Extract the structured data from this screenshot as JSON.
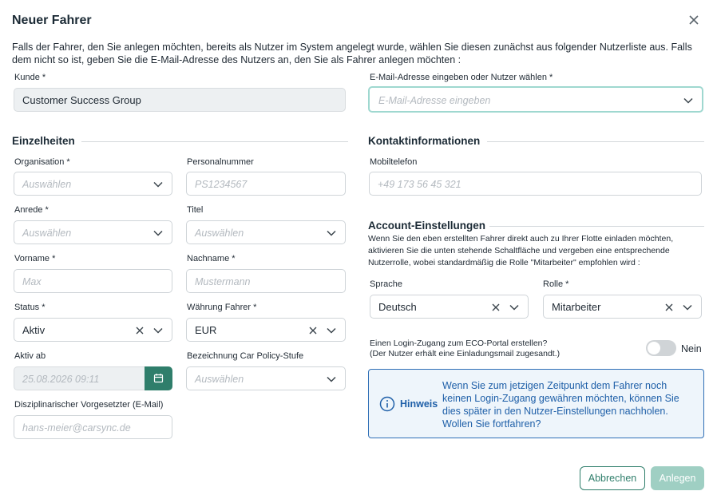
{
  "dialog": {
    "title": "Neuer Fahrer",
    "intro": "Falls der Fahrer, den Sie anlegen möchten, bereits als Nutzer im System angelegt wurde, wählen Sie diesen zunächst aus folgender Nutzerliste aus. Falls dem nicht so ist, geben Sie die E-Mail-Adresse des Nutzers an, den Sie als Fahrer anlegen möchten :"
  },
  "customer": {
    "label": "Kunde *",
    "value": "Customer Success Group"
  },
  "email": {
    "label": "E-Mail-Adresse eingeben oder Nutzer wählen *",
    "placeholder": "E-Mail-Adresse eingeben"
  },
  "details": {
    "title": "Einzelheiten",
    "organisation": {
      "label": "Organisation *",
      "placeholder": "Auswählen"
    },
    "personalnummer": {
      "label": "Personalnummer",
      "placeholder": "PS1234567"
    },
    "anrede": {
      "label": "Anrede *",
      "placeholder": "Auswählen"
    },
    "titel": {
      "label": "Titel",
      "placeholder": "Auswählen"
    },
    "vorname": {
      "label": "Vorname *",
      "placeholder": "Max"
    },
    "nachname": {
      "label": "Nachname *",
      "placeholder": "Mustermann"
    },
    "status": {
      "label": "Status *",
      "value": "Aktiv"
    },
    "waehrung": {
      "label": "Währung Fahrer *",
      "value": "EUR"
    },
    "aktiv_ab": {
      "label": "Aktiv ab",
      "placeholder": "25.08.2026 09:11"
    },
    "car_policy": {
      "label": "Bezeichnung Car Policy-Stufe",
      "placeholder": "Auswählen"
    },
    "vorgesetzter": {
      "label": "Disziplinarischer Vorgesetzter (E-Mail)",
      "placeholder": "hans-meier@carsync.de"
    }
  },
  "contact": {
    "title": "Kontaktinformationen",
    "mobil": {
      "label": "Mobiltelefon",
      "placeholder": "+49 173 56 45 321"
    }
  },
  "account": {
    "title": "Account-Einstellungen",
    "text": "Wenn Sie den eben erstellten Fahrer direkt auch zu Ihrer Flotte einladen möchten, aktivieren Sie die unten stehende Schaltfläche und vergeben eine entsprechende Nutzerrolle, wobei standardmäßig die Rolle \"Mitarbeiter\" empfohlen wird :",
    "sprache": {
      "label": "Sprache",
      "value": "Deutsch"
    },
    "rolle": {
      "label": "Rolle *",
      "value": "Mitarbeiter"
    },
    "login_line1": "Einen Login-Zugang zum ECO-Portal erstellen?",
    "login_line2": "(Der Nutzer erhält eine Einladungsmail zugesandt.)",
    "toggle_label": "Nein"
  },
  "hint": {
    "title": "Hinweis",
    "text": "Wenn Sie zum jetzigen Zeitpunkt dem Fahrer noch keinen Login-Zugang gewähren möchten, können Sie dies später in den Nutzer-Einstellungen nachholen. Wollen Sie fortfahren?"
  },
  "buttons": {
    "cancel": "Abbrechen",
    "create": "Anlegen"
  },
  "icons": {
    "close": "close-icon",
    "caret": "chevron-down-icon",
    "clear": "clear-icon",
    "calendar": "calendar-icon",
    "info": "info-icon"
  },
  "colors": {
    "primary": "#2f7e6b",
    "primary_disabled": "#9fcfc3",
    "focus": "#9fd8d0",
    "hint_border": "#2f6fb6",
    "hint_text": "#1e5fa8"
  }
}
